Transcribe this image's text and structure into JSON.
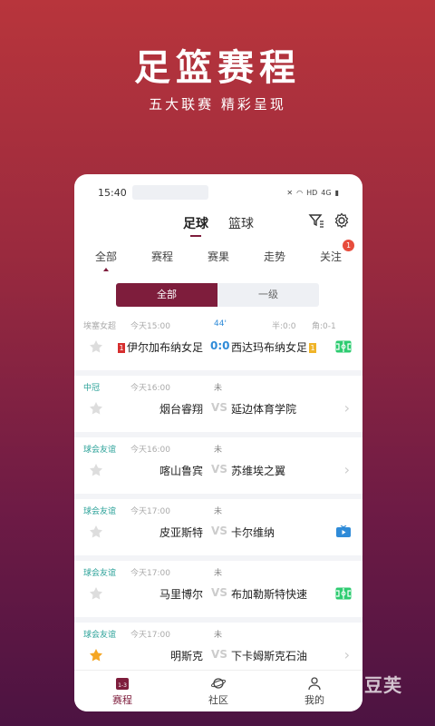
{
  "promo": {
    "title": "足篮赛程",
    "subtitle": "五大联赛 精彩呈现"
  },
  "status_bar": {
    "time": "15:40",
    "icons": [
      "mute-icon",
      "wifi-icon",
      "hd-icon",
      "4g-icon",
      "battery-icon"
    ]
  },
  "top_tabs": [
    {
      "label": "足球",
      "active": true
    },
    {
      "label": "篮球",
      "active": false
    }
  ],
  "top_icons": [
    "filter-icon",
    "settings-icon"
  ],
  "sub_tabs": [
    {
      "label": "全部",
      "active": true
    },
    {
      "label": "赛程"
    },
    {
      "label": "赛果"
    },
    {
      "label": "走势"
    },
    {
      "label": "关注",
      "badge": "1"
    }
  ],
  "segmented": [
    {
      "label": "全部",
      "active": true
    },
    {
      "label": "一级"
    }
  ],
  "matches": [
    {
      "league": "埃塞女超",
      "time": "今天15:00",
      "status": "44'",
      "half": "半:0:0",
      "corner": "角:0-1",
      "home": "伊尔加布纳女足",
      "away": "西达玛布纳女足",
      "score": "0:0",
      "home_card": "1",
      "away_card": "1",
      "starred": false,
      "right_icon": "live-field-icon"
    },
    {
      "league": "中冠",
      "time": "今天16:00",
      "status": "未",
      "home": "烟台睿翔",
      "away": "延边体育学院",
      "vs": "VS",
      "starred": false,
      "right_icon": "chevron-right-icon"
    },
    {
      "league": "球会友谊",
      "time": "今天16:00",
      "status": "未",
      "home": "喀山鲁宾",
      "away": "苏维埃之翼",
      "vs": "VS",
      "starred": false,
      "right_icon": "chevron-right-icon"
    },
    {
      "league": "球会友谊",
      "time": "今天17:00",
      "status": "未",
      "home": "皮亚斯特",
      "away": "卡尔维纳",
      "vs": "VS",
      "starred": false,
      "right_icon": "tv-icon"
    },
    {
      "league": "球会友谊",
      "time": "今天17:00",
      "status": "未",
      "home": "马里博尔",
      "away": "布加勒斯特快速",
      "vs": "VS",
      "starred": false,
      "right_icon": "live-field-icon"
    },
    {
      "league": "球会友谊",
      "time": "今天17:00",
      "status": "未",
      "home": "明斯克",
      "away": "下卡姆斯克石油",
      "vs": "VS",
      "starred": true,
      "right_icon": "chevron-right-icon"
    }
  ],
  "bottom_nav": [
    {
      "label": "赛程",
      "icon": "schedule-icon",
      "active": true
    },
    {
      "label": "社区",
      "icon": "planet-icon"
    },
    {
      "label": "我的",
      "icon": "user-icon"
    }
  ],
  "watermark": "智豆芙",
  "colors": {
    "brand": "#7e1d3c",
    "teal": "#2aa198",
    "blue": "#2f8bd8",
    "live_green": "#2ecc71"
  }
}
